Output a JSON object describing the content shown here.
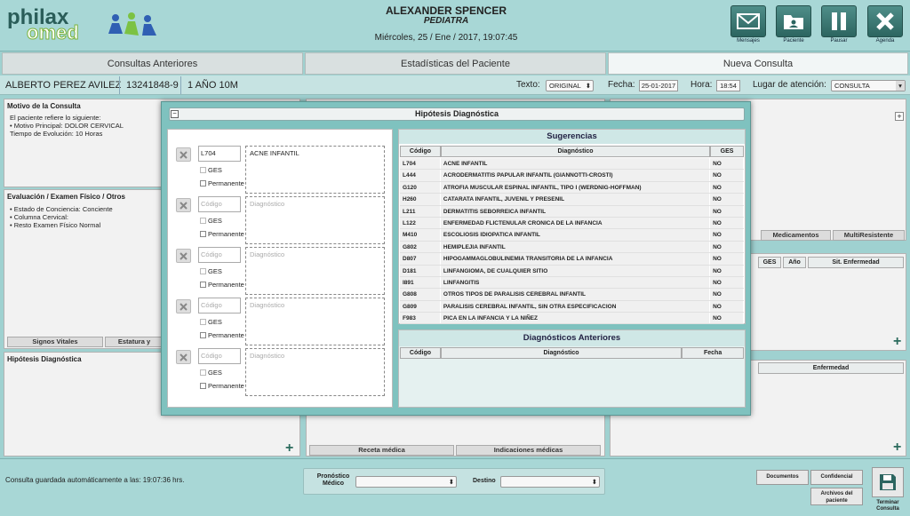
{
  "header": {
    "logo_top": "philax",
    "logo_bottom": "omed",
    "doctor_name": "ALEXANDER SPENCER",
    "doctor_role": "PEDIATRA",
    "datetime": "Miércoles, 25 / Ene / 2017, 19:07:45",
    "buttons": [
      {
        "label": "Mensajes",
        "icon": "envelope-icon"
      },
      {
        "label": "Paciente",
        "icon": "folder-icon"
      },
      {
        "label": "Pausar",
        "icon": "pause-icon"
      },
      {
        "label": "Agenda",
        "icon": "close-icon"
      }
    ]
  },
  "tabs": [
    {
      "label": "Consultas Anteriores",
      "active": false
    },
    {
      "label": "Estadísticas del Paciente",
      "active": false
    },
    {
      "label": "Nueva Consulta",
      "active": true
    }
  ],
  "patient": {
    "name": "ALBERTO PEREZ AVILEZ",
    "rut": "13241848-9",
    "age": "1 AÑO 10M",
    "texto_label": "Texto:",
    "texto_value": "ORIGINAL",
    "fecha_label": "Fecha:",
    "fecha_value": "25-01-2017",
    "hora_label": "Hora:",
    "hora_value": "18:54",
    "lugar_label": "Lugar de atención:",
    "lugar_value": "CONSULTA"
  },
  "left_panels": {
    "motivo_title": "Motivo de la Consulta",
    "motivo_lines": [
      "El paciente refiere lo siguiente:",
      "• Motivo Principal: DOLOR CERVICAL",
      "Tiempo de Evolución: 10 Horas"
    ],
    "eval_title": "Evaluación / Examen Físico / Otros",
    "eval_lines": [
      "• Estado de Conciencia: Conciente",
      "• Columna Cervical:",
      "• Resto Examen Físico Normal"
    ],
    "signos_btn": "Signos Vitales",
    "estatura_btn": "Estatura y",
    "hipotesis_title": "Hipótesis Diagnóstica"
  },
  "center_panel": {
    "receta_btn": "Receta médica",
    "indicaciones_btn": "Indicaciones médicas"
  },
  "right_panel": {
    "medicamentos_btn": "Medicamentos",
    "multiresistente_btn": "MultiResistente",
    "col_ges": "GES",
    "col_ano": "Año",
    "col_sit": "Sit. Enfermedad",
    "col_enfermedad": "Enfermedad"
  },
  "modal": {
    "title": "Hipótesis Diagnóstica",
    "codigo_placeholder": "Código",
    "diagnostico_placeholder": "Diagnóstico",
    "ges_label": "GES",
    "permanente_label": "Permanente",
    "entries": [
      {
        "code": "L704",
        "diagnosis": "ACNE INFANTIL"
      },
      {
        "code": "",
        "diagnosis": ""
      },
      {
        "code": "",
        "diagnosis": ""
      },
      {
        "code": "",
        "diagnosis": ""
      },
      {
        "code": "",
        "diagnosis": ""
      }
    ],
    "sugerencias": {
      "title": "Sugerencias",
      "col_codigo": "Código",
      "col_diagnostico": "Diagnóstico",
      "col_ges": "GES",
      "rows": [
        {
          "code": "L704",
          "diag": "ACNE INFANTIL",
          "ges": "NO"
        },
        {
          "code": "L444",
          "diag": "ACRODERMATITIS PAPULAR INFANTIL (GIANNOTTI-CROSTI)",
          "ges": "NO"
        },
        {
          "code": "G120",
          "diag": "ATROFIA MUSCULAR ESPINAL INFANTIL, TIPO I (WERDNIG-HOFFMAN)",
          "ges": "NO"
        },
        {
          "code": "H260",
          "diag": "CATARATA INFANTIL, JUVENIL Y PRESENIL",
          "ges": "NO"
        },
        {
          "code": "L211",
          "diag": "DERMATITIS SEBORREICA INFANTIL",
          "ges": "NO"
        },
        {
          "code": "L122",
          "diag": "ENFERMEDAD FLICTENULAR CRONICA DE LA INFANCIA",
          "ges": "NO"
        },
        {
          "code": "M410",
          "diag": "ESCOLIOSIS IDIOPATICA INFANTIL",
          "ges": "NO"
        },
        {
          "code": "G802",
          "diag": "HEMIPLEJIA INFANTIL",
          "ges": "NO"
        },
        {
          "code": "D807",
          "diag": "HIPOGAMMAGLOBULINEMIA TRANSITORIA DE LA INFANCIA",
          "ges": "NO"
        },
        {
          "code": "D181",
          "diag": "LINFANGIOMA, DE CUALQUIER SITIO",
          "ges": "NO"
        },
        {
          "code": "I891",
          "diag": "LINFANGITIS",
          "ges": "NO"
        },
        {
          "code": "G808",
          "diag": "OTROS TIPOS DE PARALISIS CEREBRAL INFANTIL",
          "ges": "NO"
        },
        {
          "code": "G809",
          "diag": "PARALISIS CEREBRAL INFANTIL, SIN OTRA ESPECIFICACION",
          "ges": "NO"
        },
        {
          "code": "F983",
          "diag": "PICA EN LA INFANCIA Y LA NIÑEZ",
          "ges": "NO"
        }
      ]
    },
    "anteriores": {
      "title": "Diagnósticos Anteriores",
      "col_codigo": "Código",
      "col_diagnostico": "Diagnóstico",
      "col_fecha": "Fecha"
    }
  },
  "footer": {
    "autosave": "Consulta guardada automáticamente a las: 19:07:36 hrs.",
    "pronostico_label": "Pronóstico Médico",
    "destino_label": "Destino",
    "documentos_btn": "Documentos",
    "confidencial_btn": "Confidencial",
    "archivos_btn": "Archivos del paciente",
    "terminar_label": "Terminar Consulta"
  },
  "colors": {
    "accent": "#2c6560",
    "background": "#9fd1d0"
  }
}
